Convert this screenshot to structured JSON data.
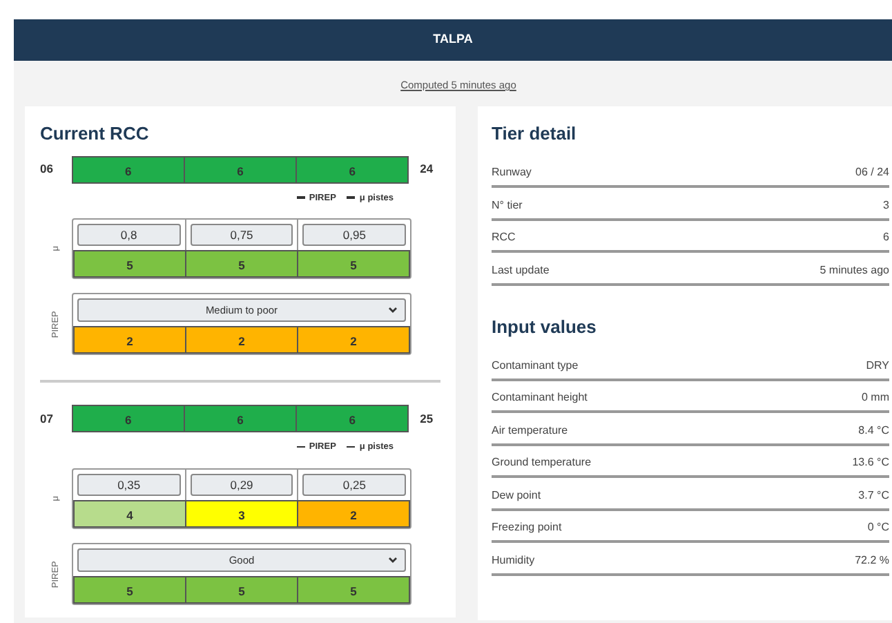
{
  "navbar": {
    "title": "TALPA"
  },
  "computed": "Computed 5 minutes ago",
  "current_rcc": {
    "title": "Current RCC",
    "runways": [
      {
        "start": "06",
        "end": "24",
        "rcc": [
          "6",
          "6",
          "6"
        ],
        "legend": [
          "PIREP",
          "μ pistes"
        ],
        "mu_label": "μ",
        "mu": {
          "values": [
            "0,8",
            "0,75",
            "0,95"
          ],
          "rcc": [
            "5",
            "5",
            "5"
          ]
        },
        "pirep_label": "PIREP",
        "pirep": {
          "value": "Medium to poor",
          "rcc": [
            "2",
            "2",
            "2"
          ]
        }
      },
      {
        "start": "07",
        "end": "25",
        "rcc": [
          "6",
          "6",
          "6"
        ],
        "legend": [
          "PIREP",
          "μ pistes"
        ],
        "mu_label": "μ",
        "mu": {
          "values": [
            "0,35",
            "0,29",
            "0,25"
          ],
          "rcc": [
            "4",
            "3",
            "2"
          ]
        },
        "pirep_label": "PIREP",
        "pirep": {
          "value": "Good",
          "rcc": [
            "5",
            "5",
            "5"
          ]
        }
      }
    ]
  },
  "tier_detail": {
    "title": "Tier detail",
    "rows": [
      {
        "label": "Runway",
        "value": "06 / 24"
      },
      {
        "label": "N° tier",
        "value": "3"
      },
      {
        "label": "RCC",
        "value": "6"
      },
      {
        "label": "Last update",
        "value": "5 minutes ago"
      }
    ]
  },
  "input_values": {
    "title": "Input values",
    "rows": [
      {
        "label": "Contaminant type",
        "value": "DRY"
      },
      {
        "label": "Contaminant height",
        "value": "0 mm"
      },
      {
        "label": "Air temperature",
        "value": "8.4 °C"
      },
      {
        "label": "Ground temperature",
        "value": "13.6 °C"
      },
      {
        "label": "Dew point",
        "value": "3.7 °C"
      },
      {
        "label": "Freezing point",
        "value": "0 °C"
      },
      {
        "label": "Humidity",
        "value": "72.2 %"
      }
    ]
  }
}
